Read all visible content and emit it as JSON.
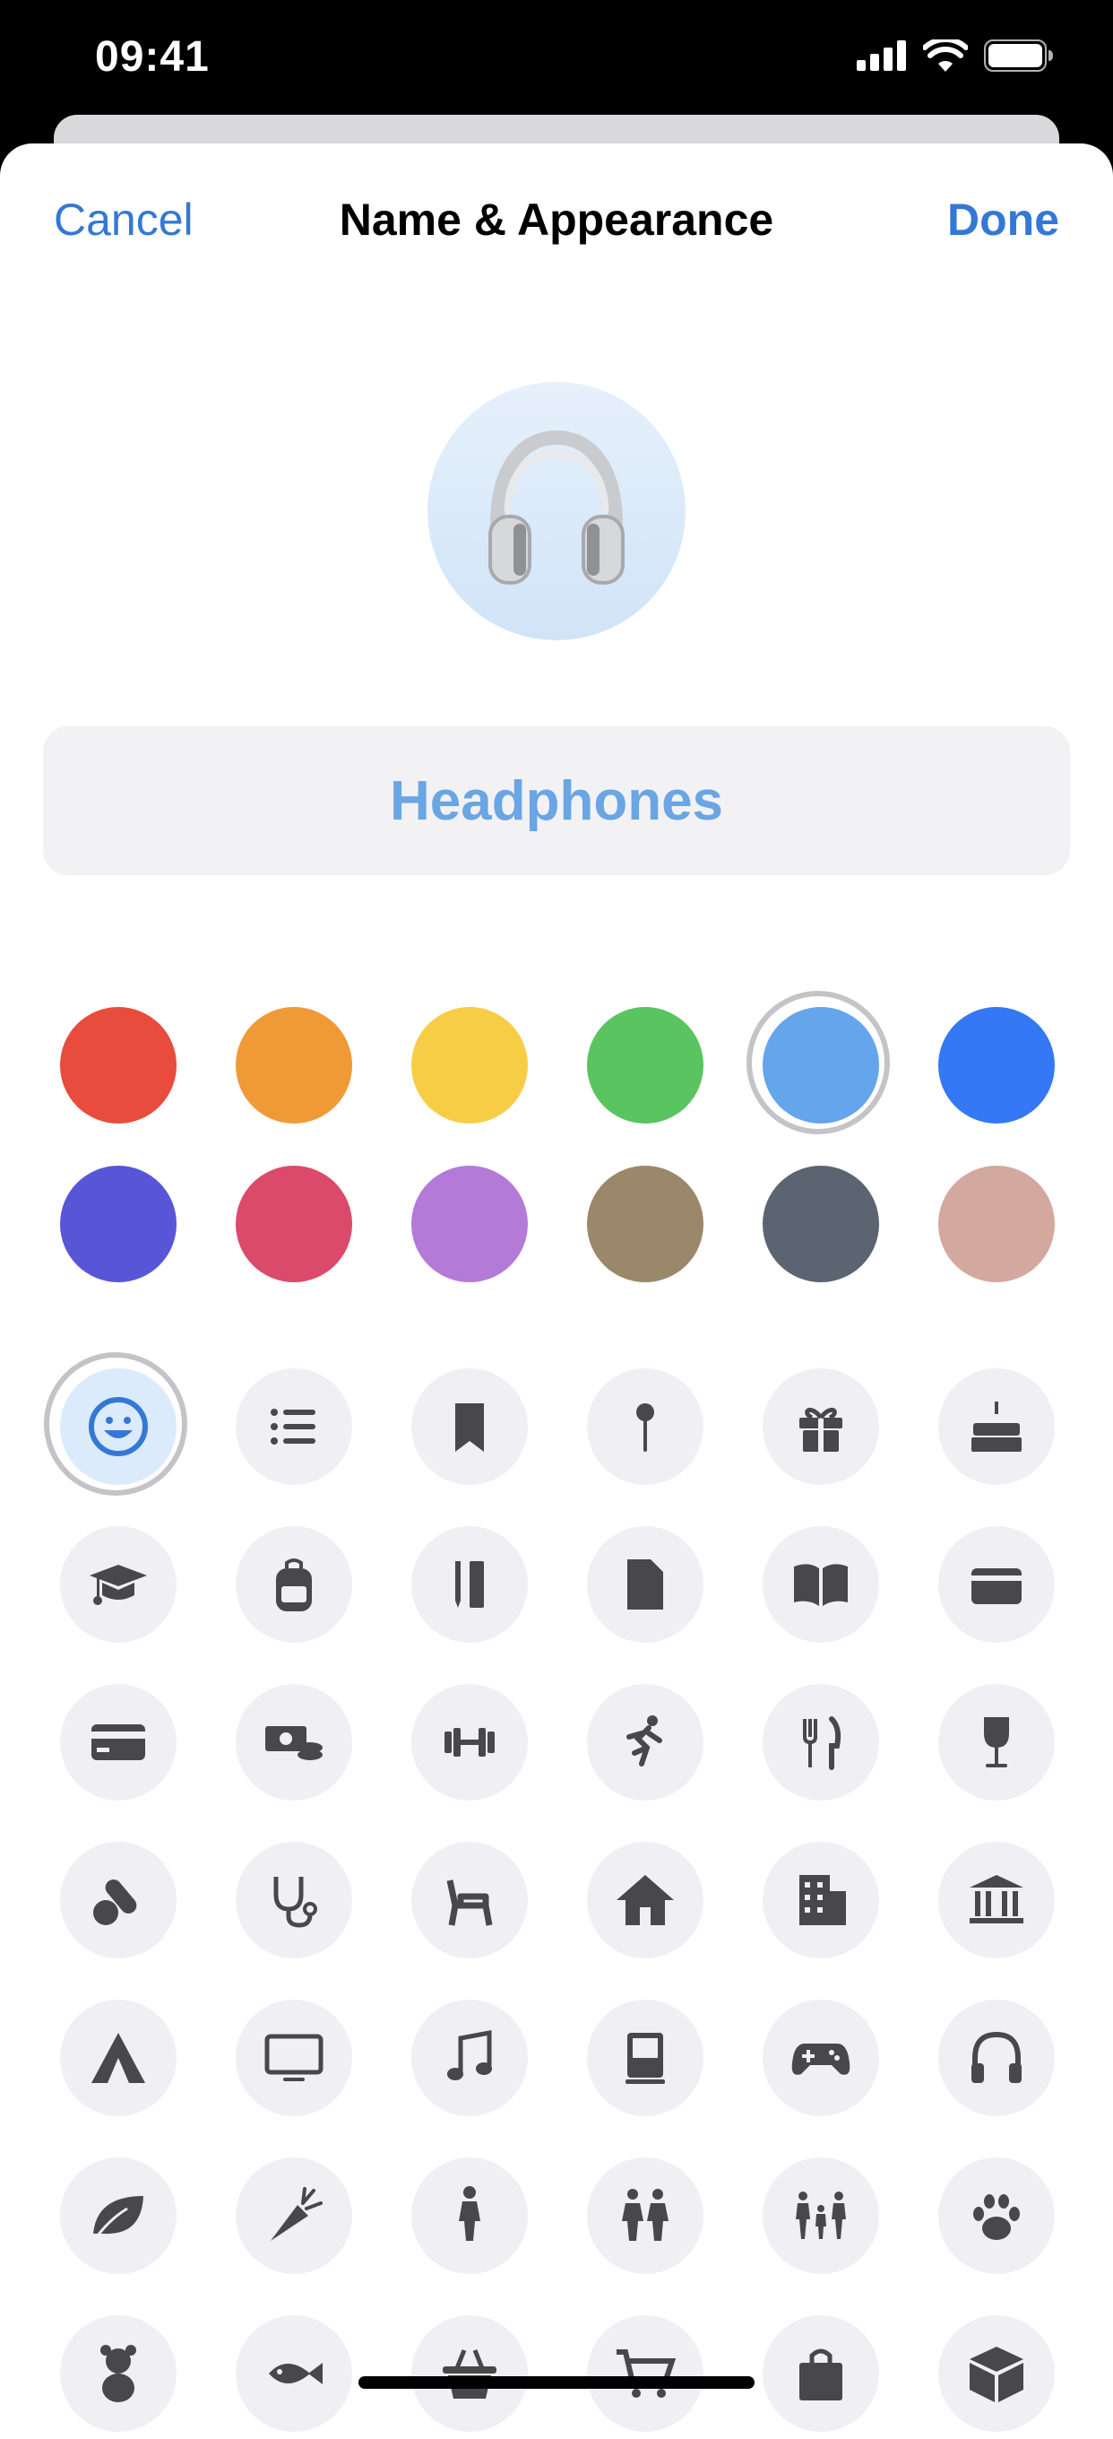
{
  "status_bar": {
    "time": "09:41",
    "icons": [
      "cellular-signal-icon",
      "wifi-icon",
      "battery-icon"
    ]
  },
  "nav": {
    "cancel_label": "Cancel",
    "title": "Name & Appearance",
    "done_label": "Done"
  },
  "preview": {
    "icon": "headphones-icon"
  },
  "name_field": {
    "value": "Headphones"
  },
  "colors": {
    "selected": "light-blue",
    "swatches": [
      {
        "name": "red",
        "hex": "#e84c3d"
      },
      {
        "name": "orange",
        "hex": "#f09a37"
      },
      {
        "name": "yellow",
        "hex": "#f7cd46"
      },
      {
        "name": "green",
        "hex": "#5ac461"
      },
      {
        "name": "light-blue",
        "hex": "#64a5ec"
      },
      {
        "name": "blue",
        "hex": "#3478f6"
      },
      {
        "name": "indigo",
        "hex": "#5856d6"
      },
      {
        "name": "pink",
        "hex": "#db4a6a"
      },
      {
        "name": "purple",
        "hex": "#b37ad8"
      },
      {
        "name": "brown",
        "hex": "#9b876a"
      },
      {
        "name": "dark-gray",
        "hex": "#5b6470"
      },
      {
        "name": "rose-gold",
        "hex": "#d3a89f"
      }
    ]
  },
  "glyphs": {
    "selected": "smiley-icon",
    "items": [
      "smiley-icon",
      "list-icon",
      "bookmark-icon",
      "pin-icon",
      "gift-icon",
      "birthday-cake-icon",
      "graduation-cap-icon",
      "backpack-icon",
      "pencil-ruler-icon",
      "document-icon",
      "book-icon",
      "wallet-icon",
      "credit-card-icon",
      "money-icon",
      "dumbbell-icon",
      "running-figure-icon",
      "fork-knife-icon",
      "wine-glass-icon",
      "pills-icon",
      "stethoscope-icon",
      "chair-icon",
      "house-icon",
      "building-icon",
      "bank-icon",
      "tent-icon",
      "monitor-icon",
      "music-note-icon",
      "computer-icon",
      "game-controller-icon",
      "headphones-outline-icon",
      "leaf-icon",
      "carrot-icon",
      "person-icon",
      "two-people-icon",
      "family-icon",
      "pawprint-icon",
      "teddy-bear-icon",
      "fish-icon",
      "basket-icon",
      "cart-icon",
      "shopping-bag-icon",
      "box-icon"
    ]
  }
}
